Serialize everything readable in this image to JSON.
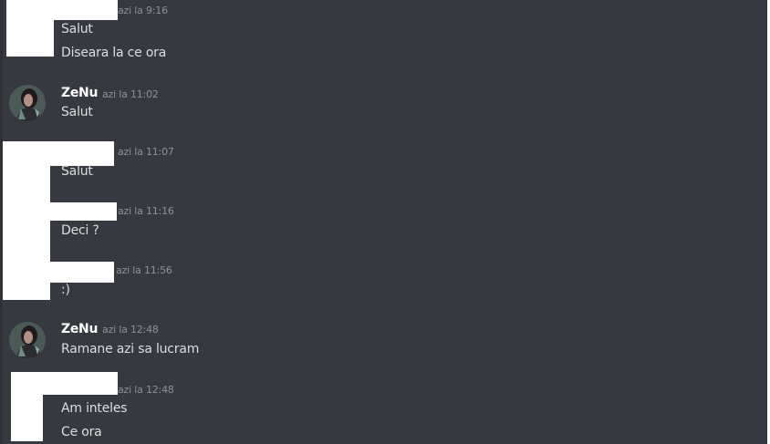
{
  "messages": {
    "m1": {
      "timestamp": "azi la 9:16",
      "lines": [
        "Salut",
        "Diseara la ce ora"
      ]
    },
    "m2": {
      "author": "ZeNu",
      "timestamp": "azi la 11:02",
      "text": "Salut"
    },
    "m3": {
      "timestamp": "azi la 11:07",
      "text": "Salut"
    },
    "m4": {
      "timestamp": "azi la 11:16",
      "text": "Deci ?"
    },
    "m5": {
      "timestamp": "azi la 11:56",
      "text": ":)"
    },
    "m6": {
      "author": "ZeNu",
      "timestamp": "azi la 12:48",
      "text": "Ramane azi sa lucram"
    },
    "m7": {
      "timestamp": "azi la 12:48",
      "lines": [
        "Am inteles",
        "Ce ora"
      ]
    }
  },
  "colors": {
    "background": "#36393f",
    "message_text": "#dcddde",
    "timestamp_text": "#8e9297",
    "username": "#ffffff",
    "redaction": "#ffffff"
  },
  "icons": {
    "avatar": "zenu-avatar-icon"
  }
}
